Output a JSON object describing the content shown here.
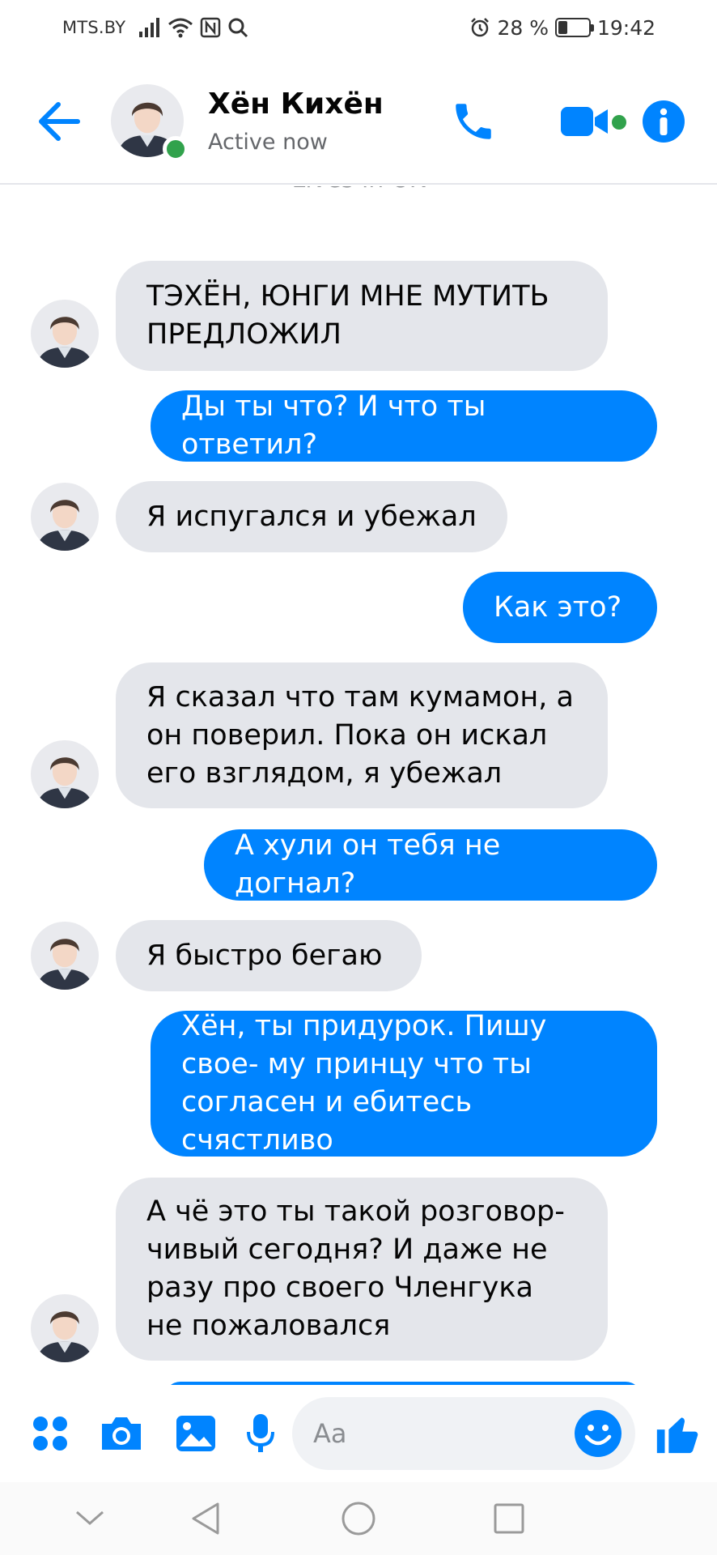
{
  "status_bar": {
    "carrier": "MTS.BY",
    "battery": "28 %",
    "battery_level": 0.28,
    "time": "19:42"
  },
  "header": {
    "name": "Хён Кихён",
    "status": "Active now"
  },
  "partial_text": "Lives in UK",
  "messages": [
    {
      "side": "in",
      "text": "ТЭХЁН, ЮНГИ МНЕ МУТИТЬ ПРЕДЛОЖИЛ",
      "avatar": true
    },
    {
      "side": "out",
      "text": "Ды ты что? И что ты ответил?"
    },
    {
      "side": "in",
      "text": "Я испугался и убежал",
      "avatar": true
    },
    {
      "side": "out",
      "text": "Как это?"
    },
    {
      "side": "in",
      "text": "Я сказал что там кумамон, а он поверил. Пока он искал его взглядом, я убежал",
      "avatar": true
    },
    {
      "side": "out",
      "text": "А хули он тебя не догнал?"
    },
    {
      "side": "in",
      "text": "Я быстро бегаю",
      "avatar": true
    },
    {
      "side": "out",
      "text": "Хён, ты придурок. Пишу свое- му принцу что ты согласен и ебитесь счястливо"
    },
    {
      "side": "in",
      "text": "А чё это ты такой розговор- чивый сегодня? И даже не разу про своего Членгука не пожаловался",
      "avatar": true
    }
  ],
  "composer": {
    "placeholder": "Aa"
  },
  "colors": {
    "accent": "#0084ff",
    "incoming_bubble": "#e4e6eb",
    "online": "#31a24c"
  },
  "icons": {
    "back": "arrow-left-icon",
    "call": "phone-icon",
    "video": "video-camera-icon",
    "info": "info-icon",
    "menu": "four-dots-icon",
    "camera": "camera-icon",
    "gallery": "image-icon",
    "mic": "microphone-icon",
    "emoji": "smiley-icon",
    "like": "thumbs-up-icon"
  }
}
